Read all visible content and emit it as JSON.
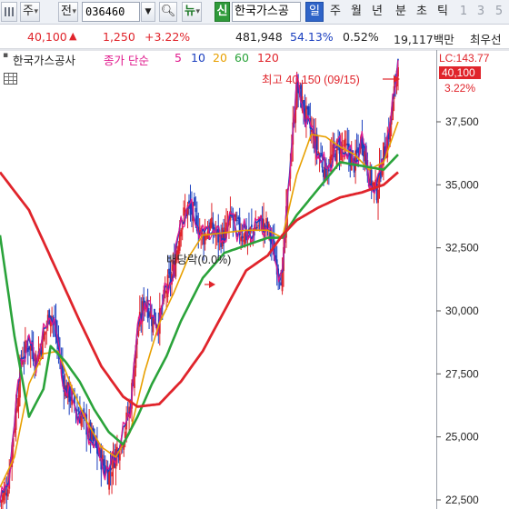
{
  "toolbar": {
    "market": "주",
    "chart_kind": "전",
    "code": "036460",
    "new_label": "뉴",
    "credit_label": "신",
    "stock_name": "한국가스공",
    "periods": [
      "일",
      "주",
      "월",
      "년",
      "분",
      "초",
      "틱"
    ],
    "active_period": "일",
    "counts": [
      "1",
      "3",
      "5"
    ]
  },
  "quote": {
    "price": "40,100",
    "direction_icon": "▲",
    "change": "1,250",
    "change_pct": "+3.22%",
    "volume": "481,948",
    "volume_ratio": "54.13%",
    "turnover": "0.52%",
    "amount": "19,117백만",
    "extra": "최우선"
  },
  "legend": {
    "stock": "한국가스공사",
    "ma_label": "종가 단순",
    "ma5": "5",
    "ma10": "10",
    "ma20": "20",
    "ma60": "60",
    "ma120": "120"
  },
  "price_axis": {
    "lc": "LC:143.77",
    "current": "40,100",
    "current_pct": "3.22%"
  },
  "annotations": {
    "high": "최고 40,150 (09/15)",
    "dividend": "배당락(0.0%)"
  },
  "colors": {
    "candle_up": "#e0242b",
    "candle_down": "#1b3fbf",
    "ma5": "#e0188c",
    "ma10": "#1b3fbf",
    "ma20": "#e8a000",
    "ma60": "#2aa33a",
    "ma120": "#e0242b"
  },
  "chart_data": {
    "type": "candlestick",
    "title": "한국가스공사",
    "yaxis": {
      "ticks": [
        22500,
        25000,
        27500,
        30000,
        32500,
        35000,
        37500
      ],
      "tick_labels": [
        "22,500",
        "25,000",
        "27,500",
        "30,000",
        "32,500",
        "35,000",
        "37,500"
      ],
      "range": [
        22500,
        40500
      ]
    },
    "close_path": [
      [
        0,
        22400
      ],
      [
        2,
        23000
      ],
      [
        4,
        25500
      ],
      [
        6,
        28200
      ],
      [
        8,
        28700
      ],
      [
        10,
        28100
      ],
      [
        12,
        28900
      ],
      [
        14,
        30100
      ],
      [
        16,
        28600
      ],
      [
        18,
        26900
      ],
      [
        20,
        26500
      ],
      [
        22,
        25900
      ],
      [
        24,
        25400
      ],
      [
        26,
        24700
      ],
      [
        28,
        24100
      ],
      [
        30,
        23500
      ],
      [
        32,
        24400
      ],
      [
        34,
        25000
      ],
      [
        36,
        26300
      ],
      [
        38,
        29100
      ],
      [
        40,
        30500
      ],
      [
        42,
        29700
      ],
      [
        44,
        29600
      ],
      [
        46,
        30900
      ],
      [
        48,
        31600
      ],
      [
        50,
        33600
      ],
      [
        52,
        34100
      ],
      [
        54,
        33700
      ],
      [
        56,
        32900
      ],
      [
        58,
        33400
      ],
      [
        60,
        32900
      ],
      [
        62,
        33000
      ],
      [
        64,
        33700
      ],
      [
        66,
        33200
      ],
      [
        68,
        33000
      ],
      [
        70,
        33200
      ],
      [
        72,
        33500
      ],
      [
        74,
        33300
      ],
      [
        76,
        32100
      ],
      [
        78,
        31300
      ],
      [
        80,
        35700
      ],
      [
        82,
        38900
      ],
      [
        84,
        38000
      ],
      [
        86,
        37100
      ],
      [
        88,
        36300
      ],
      [
        90,
        35500
      ],
      [
        92,
        36200
      ],
      [
        94,
        36600
      ],
      [
        96,
        36300
      ],
      [
        98,
        35800
      ],
      [
        100,
        36900
      ],
      [
        102,
        35300
      ],
      [
        104,
        34700
      ],
      [
        106,
        36300
      ],
      [
        108,
        37400
      ],
      [
        110,
        40100
      ]
    ],
    "ma120": [
      [
        0,
        35500
      ],
      [
        8,
        34000
      ],
      [
        16,
        31500
      ],
      [
        22,
        29600
      ],
      [
        28,
        27800
      ],
      [
        34,
        26600
      ],
      [
        38,
        26200
      ],
      [
        44,
        26300
      ],
      [
        50,
        27200
      ],
      [
        56,
        28400
      ],
      [
        62,
        30000
      ],
      [
        68,
        31600
      ],
      [
        74,
        32200
      ],
      [
        78,
        33000
      ],
      [
        82,
        33600
      ],
      [
        88,
        34100
      ],
      [
        94,
        34500
      ],
      [
        100,
        34700
      ],
      [
        106,
        35000
      ],
      [
        110,
        35500
      ]
    ],
    "ma60": [
      [
        0,
        33000
      ],
      [
        4,
        29000
      ],
      [
        8,
        25800
      ],
      [
        12,
        26900
      ],
      [
        14,
        28600
      ],
      [
        18,
        28000
      ],
      [
        22,
        27200
      ],
      [
        26,
        26100
      ],
      [
        30,
        25200
      ],
      [
        34,
        24700
      ],
      [
        38,
        25800
      ],
      [
        42,
        27100
      ],
      [
        46,
        28200
      ],
      [
        50,
        29600
      ],
      [
        56,
        31300
      ],
      [
        62,
        32300
      ],
      [
        68,
        32600
      ],
      [
        74,
        32900
      ],
      [
        78,
        32900
      ],
      [
        82,
        33800
      ],
      [
        86,
        34500
      ],
      [
        90,
        35200
      ],
      [
        94,
        35900
      ],
      [
        98,
        35800
      ],
      [
        102,
        35700
      ],
      [
        106,
        35600
      ],
      [
        110,
        36200
      ]
    ],
    "ma20": [
      [
        0,
        23000
      ],
      [
        4,
        24200
      ],
      [
        8,
        27100
      ],
      [
        12,
        28300
      ],
      [
        16,
        28400
      ],
      [
        20,
        26900
      ],
      [
        24,
        25600
      ],
      [
        28,
        24600
      ],
      [
        32,
        24200
      ],
      [
        36,
        25200
      ],
      [
        40,
        27600
      ],
      [
        44,
        29500
      ],
      [
        48,
        30700
      ],
      [
        52,
        32100
      ],
      [
        56,
        33000
      ],
      [
        62,
        33100
      ],
      [
        68,
        33200
      ],
      [
        74,
        33200
      ],
      [
        78,
        32900
      ],
      [
        82,
        35400
      ],
      [
        86,
        37000
      ],
      [
        90,
        36900
      ],
      [
        94,
        36500
      ],
      [
        98,
        36200
      ],
      [
        102,
        35600
      ],
      [
        106,
        35900
      ],
      [
        110,
        37500
      ]
    ]
  }
}
